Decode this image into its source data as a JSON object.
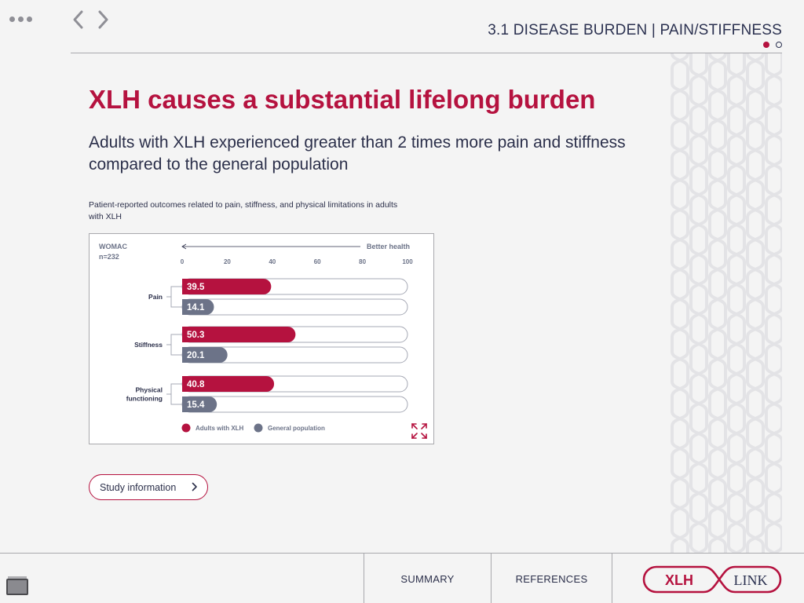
{
  "header": {
    "section_title": "3.1 DISEASE BURDEN | PAIN/STIFFNESS",
    "page_dots": [
      {
        "state": "active"
      },
      {
        "state": "inactive"
      }
    ]
  },
  "icons": {
    "menu": "more-dots-icon",
    "prev": "chevron-left-icon",
    "next": "chevron-right-icon",
    "expand": "expand-icon",
    "chevron": "chevron-right-icon",
    "thumbnail": "slide-thumbnail-icon"
  },
  "colors": {
    "accent": "#b5123f",
    "navy": "#2b3150",
    "gray_bar": "#6c7388",
    "background": "#f4f4f4"
  },
  "main": {
    "headline": "XLH causes a substantial lifelong burden",
    "subhead": "Adults with XLH experienced greater than 2 times more pain and stiffness compared to the general population",
    "chart_caption": "Patient-reported outcomes related to pain, stiffness, and physical limitations in adults with XLH"
  },
  "chart_data": {
    "type": "bar",
    "orientation": "horizontal",
    "scale_label": "WOMAC",
    "sample_label": "n=232",
    "direction_label": "Better health",
    "xlim": [
      0,
      100
    ],
    "ticks": [
      "0",
      "20",
      "40",
      "60",
      "80",
      "100"
    ],
    "categories": [
      "Pain",
      "Stiffness",
      "Physical functioning"
    ],
    "series": [
      {
        "name": "Adults with XLH",
        "color": "#b5123f",
        "values": [
          39.5,
          50.3,
          40.8
        ],
        "labels": [
          "39.5",
          "50.3",
          "40.8"
        ]
      },
      {
        "name": "General population",
        "color": "#6c7388",
        "values": [
          14.1,
          20.1,
          15.4
        ],
        "labels": [
          "14.1",
          "20.1",
          "15.4"
        ]
      }
    ],
    "legend_position": "bottom"
  },
  "buttons": {
    "study_info": "Study information"
  },
  "footer": {
    "summary": "SUMMARY",
    "references": "REFERENCES",
    "logo_left": "XLH",
    "logo_right": "LINK"
  }
}
